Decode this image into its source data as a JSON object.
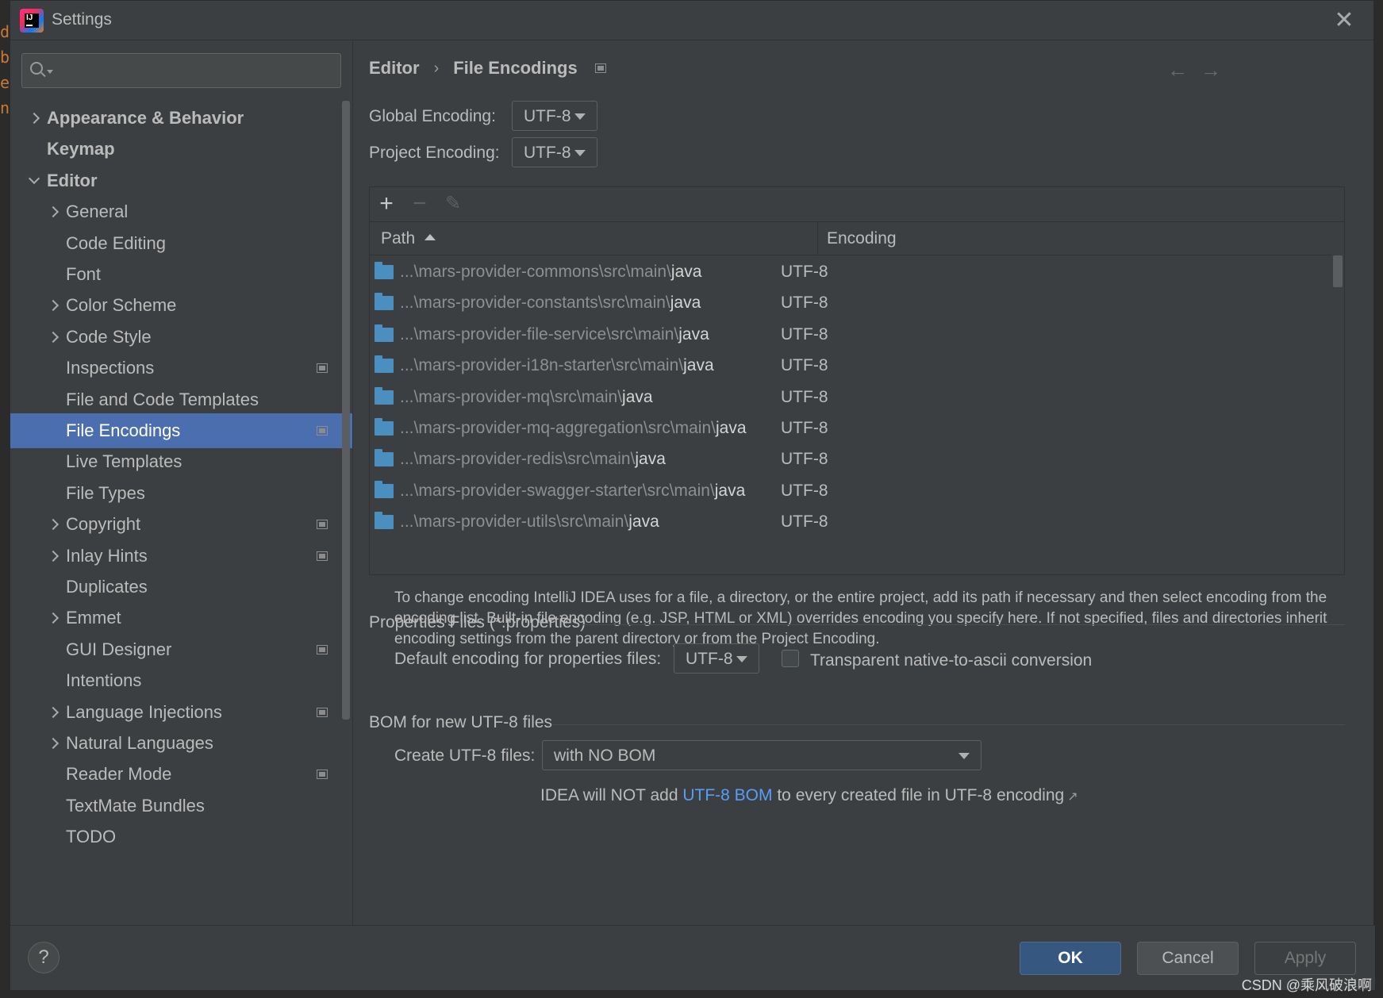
{
  "window": {
    "title": "Settings"
  },
  "search": {
    "placeholder": ""
  },
  "sidebar": {
    "items": [
      {
        "label": "Appearance & Behavior",
        "level": 0,
        "expander": "collapsed",
        "bold": true,
        "project_scope": false,
        "selected": false
      },
      {
        "label": "Keymap",
        "level": 0,
        "expander": "none",
        "bold": true,
        "project_scope": false,
        "selected": false
      },
      {
        "label": "Editor",
        "level": 0,
        "expander": "expanded",
        "bold": true,
        "project_scope": false,
        "selected": false
      },
      {
        "label": "General",
        "level": 1,
        "expander": "collapsed",
        "bold": false,
        "project_scope": false,
        "selected": false
      },
      {
        "label": "Code Editing",
        "level": 1,
        "expander": "none",
        "bold": false,
        "project_scope": false,
        "selected": false
      },
      {
        "label": "Font",
        "level": 1,
        "expander": "none",
        "bold": false,
        "project_scope": false,
        "selected": false
      },
      {
        "label": "Color Scheme",
        "level": 1,
        "expander": "collapsed",
        "bold": false,
        "project_scope": false,
        "selected": false
      },
      {
        "label": "Code Style",
        "level": 1,
        "expander": "collapsed",
        "bold": false,
        "project_scope": false,
        "selected": false
      },
      {
        "label": "Inspections",
        "level": 1,
        "expander": "none",
        "bold": false,
        "project_scope": true,
        "selected": false
      },
      {
        "label": "File and Code Templates",
        "level": 1,
        "expander": "none",
        "bold": false,
        "project_scope": false,
        "selected": false
      },
      {
        "label": "File Encodings",
        "level": 1,
        "expander": "none",
        "bold": false,
        "project_scope": true,
        "selected": true
      },
      {
        "label": "Live Templates",
        "level": 1,
        "expander": "none",
        "bold": false,
        "project_scope": false,
        "selected": false
      },
      {
        "label": "File Types",
        "level": 1,
        "expander": "none",
        "bold": false,
        "project_scope": false,
        "selected": false
      },
      {
        "label": "Copyright",
        "level": 1,
        "expander": "collapsed",
        "bold": false,
        "project_scope": true,
        "selected": false
      },
      {
        "label": "Inlay Hints",
        "level": 1,
        "expander": "collapsed",
        "bold": false,
        "project_scope": true,
        "selected": false
      },
      {
        "label": "Duplicates",
        "level": 1,
        "expander": "none",
        "bold": false,
        "project_scope": false,
        "selected": false
      },
      {
        "label": "Emmet",
        "level": 1,
        "expander": "collapsed",
        "bold": false,
        "project_scope": false,
        "selected": false
      },
      {
        "label": "GUI Designer",
        "level": 1,
        "expander": "none",
        "bold": false,
        "project_scope": true,
        "selected": false
      },
      {
        "label": "Intentions",
        "level": 1,
        "expander": "none",
        "bold": false,
        "project_scope": false,
        "selected": false
      },
      {
        "label": "Language Injections",
        "level": 1,
        "expander": "collapsed",
        "bold": false,
        "project_scope": true,
        "selected": false
      },
      {
        "label": "Natural Languages",
        "level": 1,
        "expander": "collapsed",
        "bold": false,
        "project_scope": false,
        "selected": false
      },
      {
        "label": "Reader Mode",
        "level": 1,
        "expander": "none",
        "bold": false,
        "project_scope": true,
        "selected": false
      },
      {
        "label": "TextMate Bundles",
        "level": 1,
        "expander": "none",
        "bold": false,
        "project_scope": false,
        "selected": false
      },
      {
        "label": "TODO",
        "level": 1,
        "expander": "none",
        "bold": false,
        "project_scope": false,
        "selected": false
      }
    ]
  },
  "breadcrumb": {
    "parent": "Editor",
    "separator": "›",
    "current": "File Encodings"
  },
  "nav": {
    "back": "←",
    "forward": "→"
  },
  "global_encoding": {
    "label": "Global Encoding:",
    "value": "UTF-8"
  },
  "project_encoding": {
    "label": "Project Encoding:",
    "value": "UTF-8"
  },
  "table": {
    "toolbar": {
      "add": "+",
      "remove": "−",
      "edit": "✎"
    },
    "columns": {
      "path": "Path",
      "encoding": "Encoding"
    },
    "rows": [
      {
        "path_prefix": "...\\mars-provider-commons\\src\\main\\",
        "path_leaf": "java",
        "encoding": "UTF-8"
      },
      {
        "path_prefix": "...\\mars-provider-constants\\src\\main\\",
        "path_leaf": "java",
        "encoding": "UTF-8"
      },
      {
        "path_prefix": "...\\mars-provider-file-service\\src\\main\\",
        "path_leaf": "java",
        "encoding": "UTF-8"
      },
      {
        "path_prefix": "...\\mars-provider-i18n-starter\\src\\main\\",
        "path_leaf": "java",
        "encoding": "UTF-8"
      },
      {
        "path_prefix": "...\\mars-provider-mq\\src\\main\\",
        "path_leaf": "java",
        "encoding": "UTF-8"
      },
      {
        "path_prefix": "...\\mars-provider-mq-aggregation\\src\\main\\",
        "path_leaf": "java",
        "encoding": "UTF-8"
      },
      {
        "path_prefix": "...\\mars-provider-redis\\src\\main\\",
        "path_leaf": "java",
        "encoding": "UTF-8"
      },
      {
        "path_prefix": "...\\mars-provider-swagger-starter\\src\\main\\",
        "path_leaf": "java",
        "encoding": "UTF-8"
      },
      {
        "path_prefix": "...\\mars-provider-utils\\src\\main\\",
        "path_leaf": "java",
        "encoding": "UTF-8"
      }
    ]
  },
  "help_text": "To change encoding IntelliJ IDEA uses for a file, a directory, or the entire project, add its path if necessary and then select encoding from the encoding list. Built-in file encoding (e.g. JSP, HTML or XML) overrides encoding you specify here. If not specified, files and directories inherit encoding settings from the parent directory or from the Project Encoding.",
  "properties": {
    "group_title": "Properties Files (*.properties)",
    "default_label": "Default encoding for properties files:",
    "default_value": "UTF-8",
    "transparent_label": "Transparent native-to-ascii conversion",
    "transparent_checked": false
  },
  "bom": {
    "group_title": "BOM for new UTF-8 files",
    "create_label": "Create UTF-8 files:",
    "create_value": "with NO BOM",
    "note_before": "IDEA will NOT add ",
    "note_link": "UTF-8 BOM",
    "note_after": " to every created file in UTF-8 encoding",
    "note_ext": "↗"
  },
  "footer": {
    "help": "?",
    "ok": "OK",
    "cancel": "Cancel",
    "apply": "Apply"
  },
  "watermark": "CSDN @乘风破浪啊",
  "colors": {
    "selection": "#4b6eaf",
    "link": "#589df6",
    "ok_button": "#365880",
    "background": "#3c3f41"
  },
  "icons": {
    "app": "intellij-idea-icon",
    "folder": "folder-icon",
    "project_scope": "project-scope-icon"
  }
}
